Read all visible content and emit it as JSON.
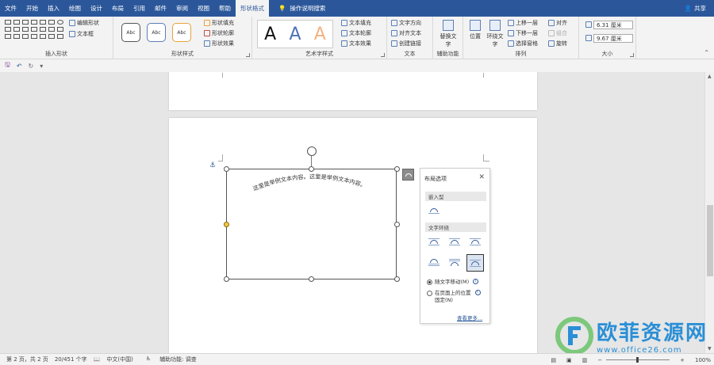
{
  "tabs": [
    "文件",
    "开始",
    "插入",
    "绘图",
    "设计",
    "布局",
    "引用",
    "邮件",
    "审阅",
    "视图",
    "帮助",
    "形状格式",
    "操作说明搜索"
  ],
  "active_tab": "形状格式",
  "share_label": "共享",
  "ribbon": {
    "insert_shapes": {
      "label": "插入形状",
      "edit_shape": "编辑形状",
      "text_box": "文本框"
    },
    "shape_styles": {
      "label": "形状样式",
      "preset": "Abc",
      "fill": "形状填充",
      "outline": "形状轮廓",
      "effect": "形状效果"
    },
    "wordart": {
      "label": "艺术字样式",
      "glyph": "A",
      "text_fill": "文本填充",
      "text_outline": "文本轮廓",
      "text_effect": "文本效果"
    },
    "text": {
      "label": "文本",
      "direction": "文字方向",
      "align": "对齐文本",
      "link": "创建链接"
    },
    "accessibility": {
      "label": "辅助功能",
      "alt_text": "替换文字"
    },
    "arrange": {
      "label": "排列",
      "position": "位置",
      "wrap": "环绕文字",
      "forward": "上移一层",
      "backward": "下移一层",
      "selection": "选择窗格",
      "align": "对齐",
      "group": "组合",
      "rotate": "旋转"
    },
    "size": {
      "label": "大小",
      "height": "6.31 厘米",
      "width": "9.67 厘米"
    }
  },
  "document": {
    "arc_text": "这里是举例文本内容。这里是举例文本内容。"
  },
  "layout_panel": {
    "title": "布局选项",
    "close": "✕",
    "inline_section": "嵌入型",
    "wrap_section": "文字环绕",
    "radio_move": "随文字移动(M)",
    "radio_fixed_line1": "在页面上的位置",
    "radio_fixed_line2": "固定(N)",
    "more_link": "查看更多..."
  },
  "status": {
    "page": "第 2 页，共 2 页",
    "words": "20/451 个字",
    "lang": "中文(中国)",
    "accessibility": "辅助功能: 调查",
    "zoom": "100%"
  },
  "watermark": {
    "cn": "欧菲资源网",
    "url": "www.office26.com"
  },
  "colors": {
    "ribbon_blue": "#2b579a",
    "accent_orange": "#e8a33d",
    "watermark_blue": "#2a8fd6"
  }
}
